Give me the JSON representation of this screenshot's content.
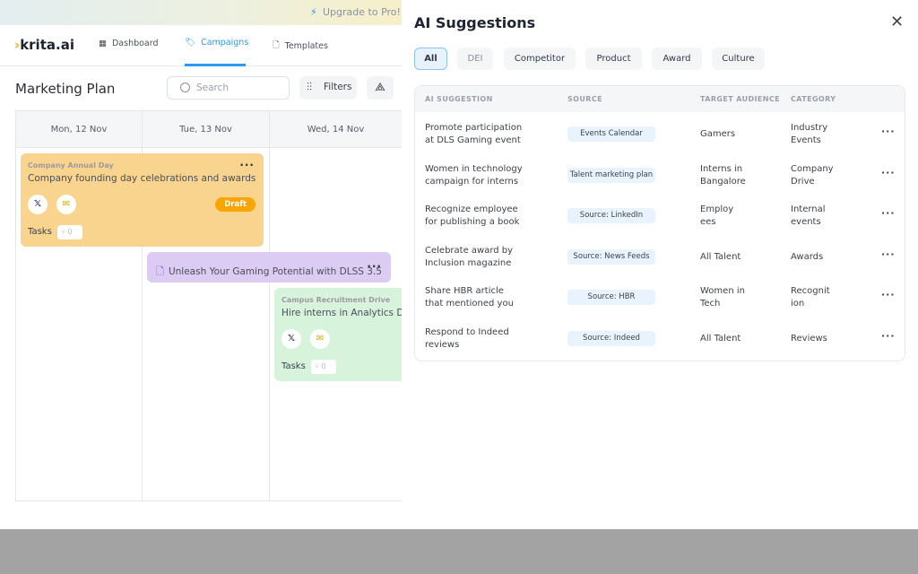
{
  "banner": {
    "text": "Upgrade to Pro!  C",
    "icon": "bolt-icon"
  },
  "nav": {
    "logo": "krita.ai",
    "items": [
      {
        "label": "Dashboard",
        "icon": "grid-icon"
      },
      {
        "label": "Campaigns",
        "icon": "tag-icon",
        "active": true
      },
      {
        "label": "Templates",
        "icon": "file-icon"
      }
    ]
  },
  "page": {
    "title": "Marketing Plan",
    "search_placeholder": "Search",
    "filters_label": "Filters"
  },
  "calendar": {
    "days": [
      "Mon, 12 Nov",
      "Tue, 13 Nov",
      "Wed, 14 Nov"
    ],
    "events": [
      {
        "category": "Company Annual Day",
        "title": "Company founding day celebrations and awards",
        "status": "Draft",
        "tasks_label": "Tasks",
        "task_count": "0",
        "color": "#f8d48e"
      },
      {
        "title": "Unleash Your Gaming Potential with DLSS 3.5",
        "color": "#dccbf3"
      },
      {
        "category": "Campus Recruitment Drive",
        "title": "Hire interns in Analytics Division",
        "tasks_label": "Tasks",
        "task_count": "0",
        "color": "#d8f3dc"
      }
    ]
  },
  "panel": {
    "title": "AI Suggestions",
    "filters": [
      "All",
      "DEI",
      "Competitor",
      "Product",
      "Award",
      "Culture"
    ],
    "active_filter": "All",
    "columns": [
      "AI SUGGESTION",
      "SOURCE",
      "TARGET AUDIENCE",
      "CATEGORY"
    ],
    "rows": [
      {
        "suggestion": "Promote participation\nat DLS Gaming event",
        "source": "Events Calendar",
        "audience": "Gamers",
        "category": "Industry\nEvents"
      },
      {
        "suggestion": "Women in technology\ncampaign for interns",
        "source": "Talent marketing plan",
        "audience": "Interns in\nBangalore",
        "category": "Company\nDrive"
      },
      {
        "suggestion": "Recognize employee\nfor publishing a book",
        "source": "Source: LinkedIn",
        "audience": "Employ\nees",
        "category": "Internal\nevents"
      },
      {
        "suggestion": "Celebrate award by\nInclusion magazine",
        "source": "Source: News Feeds",
        "audience": "All Talent",
        "category": "Awards"
      },
      {
        "suggestion": "Share HBR article\nthat mentioned you",
        "source": "Source: HBR",
        "audience": "Women in\nTech",
        "category": "Recognit\nion"
      },
      {
        "suggestion": "Respond to Indeed\nreviews",
        "source": "Source: Indeed",
        "audience": "All Talent",
        "category": "Reviews"
      }
    ]
  },
  "colors": {
    "accent": "#2b9af3",
    "draft": "#f9a503"
  }
}
